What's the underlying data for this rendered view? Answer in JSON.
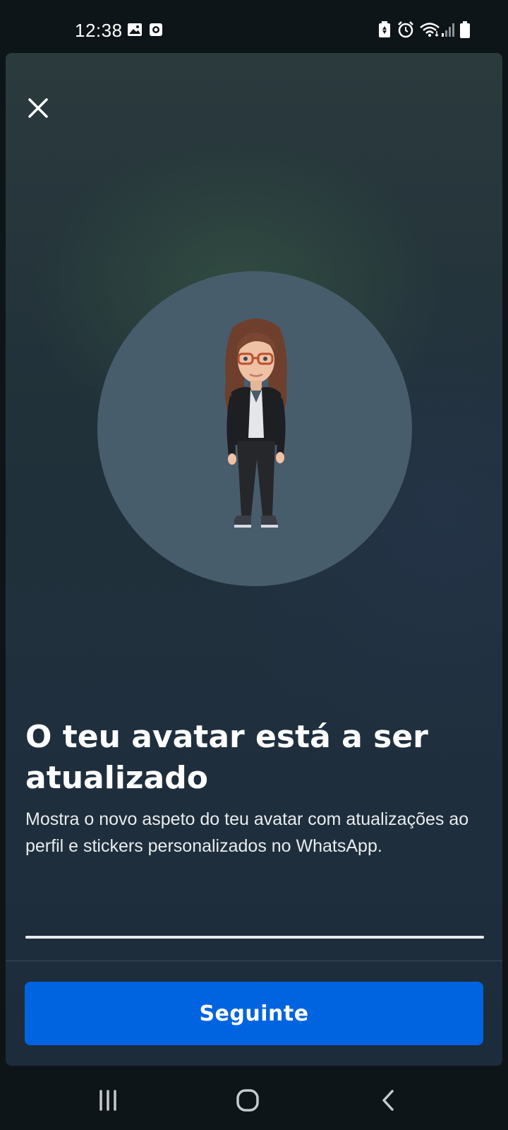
{
  "status_bar": {
    "time": "12:38",
    "icons": [
      "gallery-icon",
      "record-icon",
      "battery-saver-icon",
      "alarm-icon",
      "wifi-icon",
      "signal-icon",
      "battery-icon"
    ]
  },
  "sheet": {
    "close_icon": "close-icon",
    "title": "O teu avatar está a ser atualizado",
    "description": "Mostra o novo aspeto do teu avatar com atualizações ao perfil e stickers personalizados no WhatsApp.",
    "progress": 1.0,
    "next_button_label": "Seguinte",
    "accent_color": "#0064e0"
  },
  "nav_bar": {
    "buttons": [
      "recents-icon",
      "home-icon",
      "back-icon"
    ]
  }
}
